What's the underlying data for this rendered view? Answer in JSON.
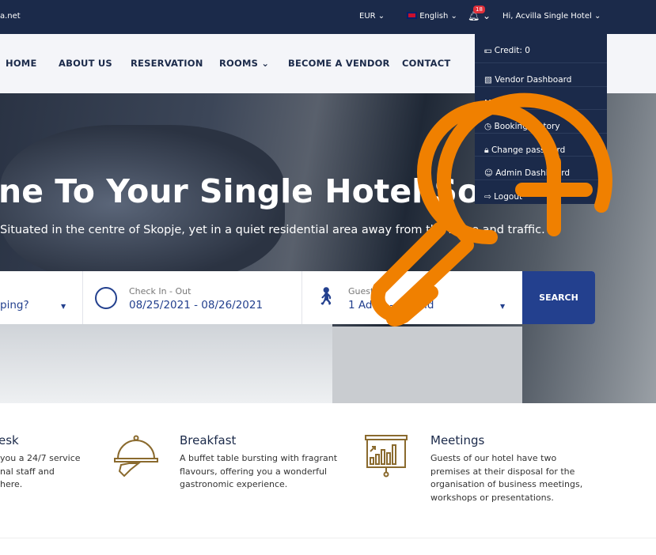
{
  "topbar": {
    "brand": "a.net",
    "currency": "EUR",
    "language": "English",
    "notifications": "18",
    "user": "Hi, Acvilla Single Hotel"
  },
  "nav": [
    "HOME",
    "ABOUT US",
    "RESERVATION",
    "ROOMS",
    "BECOME A VENDOR",
    "CONTACT"
  ],
  "user_menu": [
    "Credit: 0",
    "Vendor Dashboard",
    "My profile",
    "Booking History",
    "Change password",
    "Admin Dashboard",
    "Logout"
  ],
  "hero": {
    "title": "ne To Your Single Hotel Soft",
    "subtitle": "Situated in the centre of Skopje, yet in a quiet residential area away from the noise and traffic."
  },
  "search": {
    "destination": "ping?",
    "checkin_label": "Check In - Out",
    "checkin_value": "08/25/2021 - 08/26/2021",
    "guests_label": "Guests",
    "guests_value": "1 Adult - 0 Child",
    "button": "SEARCH"
  },
  "features": [
    {
      "title": "esk",
      "text": [
        "you a 24/7 service",
        "nal staff and",
        "here."
      ]
    },
    {
      "title": "Breakfast",
      "text": [
        "A buffet table bursting with fragrant",
        "flavours, offering you a wonderful",
        "gastronomic experience."
      ]
    },
    {
      "title": "Meetings",
      "text": [
        "Guests of our hotel have two",
        "premises at their disposal for the",
        "organisation of business meetings,",
        "workshops or presentations."
      ]
    }
  ],
  "colors": {
    "navy": "#1b2a4a",
    "accent": "#23408e",
    "gold": "#8a6a2e",
    "overlay": "#f08000"
  }
}
